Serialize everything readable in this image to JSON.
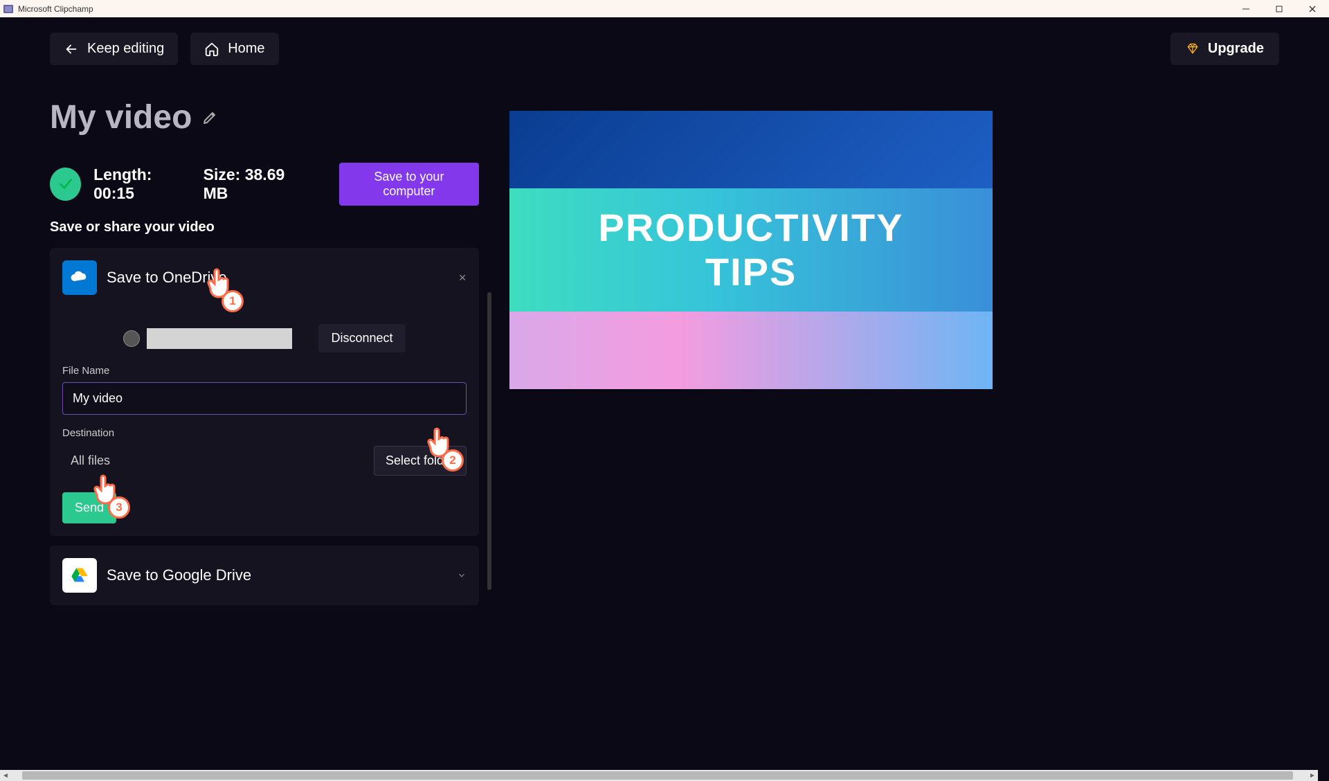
{
  "titlebar": {
    "app_name": "Microsoft Clipchamp"
  },
  "nav": {
    "keep_editing": "Keep editing",
    "home": "Home",
    "upgrade": "Upgrade"
  },
  "video": {
    "title": "My video"
  },
  "status": {
    "length_label": "Length:",
    "length_value": "00:15",
    "size_label": "Size:",
    "size_value": "38.69 MB",
    "save_computer": "Save to your computer"
  },
  "share": {
    "heading": "Save or share your video"
  },
  "onedrive": {
    "title": "Save to OneDrive",
    "disconnect": "Disconnect",
    "file_name_label": "File Name",
    "file_name_value": "My video",
    "destination_label": "Destination",
    "destination_value": "All files",
    "select_folder": "Select folder",
    "send": "Send"
  },
  "gdrive": {
    "title": "Save to Google Drive"
  },
  "preview": {
    "line1": "PRODUCTIVITY",
    "line2": "TIPS"
  },
  "markers": {
    "m1": "1",
    "m2": "2",
    "m3": "3"
  }
}
